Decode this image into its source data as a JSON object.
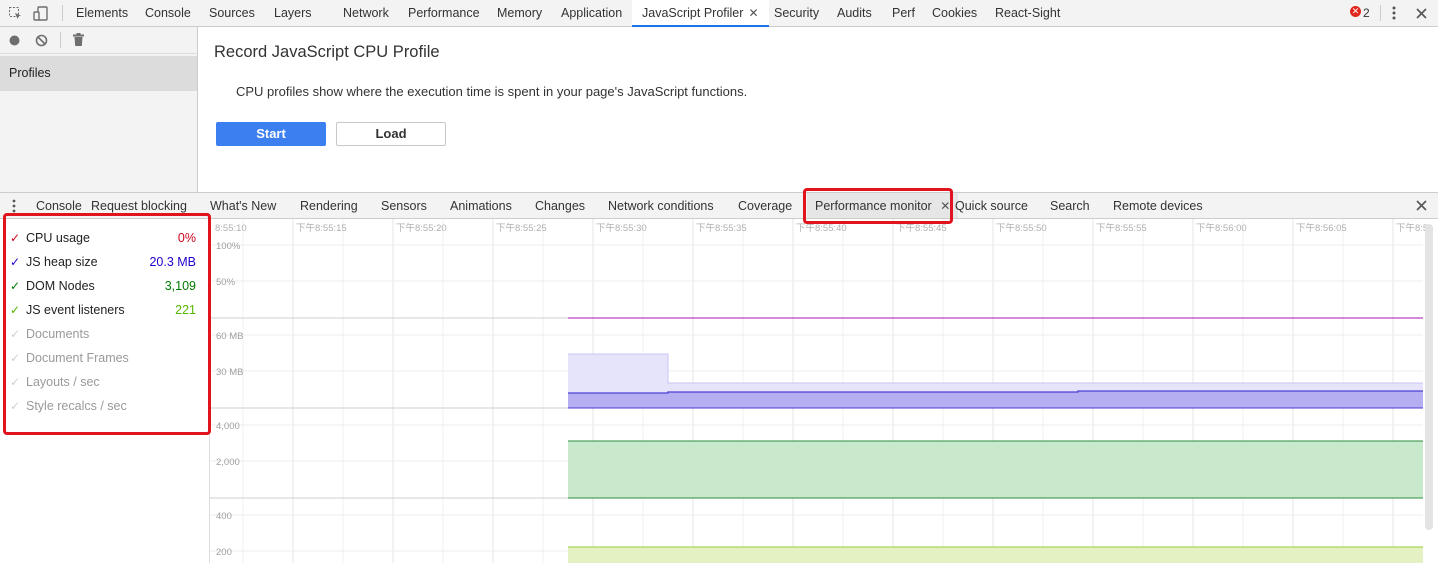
{
  "toolbar": {
    "tabs": [
      "Elements",
      "Console",
      "Sources",
      "Layers",
      "Network",
      "Performance",
      "Memory",
      "Application",
      "JavaScript Profiler",
      "Security",
      "Audits",
      "Perf",
      "Cookies",
      "React-Sight"
    ],
    "active_tab": "JavaScript Profiler",
    "error_count": "2",
    "icons": [
      "inspect-icon",
      "device-toggle-icon",
      "error-icon",
      "more-vert-icon",
      "close-icon"
    ]
  },
  "profiler": {
    "toolbar_icons": [
      "record-icon",
      "clear-icon",
      "trash-icon"
    ],
    "sidebar_item": "Profiles",
    "title": "Record JavaScript CPU Profile",
    "description": "CPU profiles show where the execution time is spent in your page's JavaScript functions.",
    "start_label": "Start",
    "load_label": "Load"
  },
  "drawer": {
    "tabs": [
      "Console",
      "Request blocking",
      "What's New",
      "Rendering",
      "Sensors",
      "Animations",
      "Changes",
      "Network conditions",
      "Coverage",
      "Performance monitor",
      "Quick source",
      "Search",
      "Remote devices"
    ],
    "active_tab": "Performance monitor"
  },
  "metrics": [
    {
      "label": "CPU usage",
      "value": "0%",
      "enabled": true,
      "color": "#d0021b"
    },
    {
      "label": "JS heap size",
      "value": "20.3 MB",
      "enabled": true,
      "color": "#2200cc"
    },
    {
      "label": "DOM Nodes",
      "value": "3,109",
      "enabled": true,
      "color": "#007a00"
    },
    {
      "label": "JS event listeners",
      "value": "221",
      "enabled": true,
      "color": "#55b700"
    },
    {
      "label": "Documents",
      "value": "",
      "enabled": false,
      "color": "#aaaaaa"
    },
    {
      "label": "Document Frames",
      "value": "",
      "enabled": false,
      "color": "#aaaaaa"
    },
    {
      "label": "Layouts / sec",
      "value": "",
      "enabled": false,
      "color": "#aaaaaa"
    },
    {
      "label": "Style recalcs / sec",
      "value": "",
      "enabled": false,
      "color": "#aaaaaa"
    }
  ],
  "chart_data": {
    "type": "area",
    "x_ticks": [
      "8:55:10",
      "下午8:55:15",
      "下午8:55:20",
      "下午8:55:25",
      "下午8:55:30",
      "下午8:55:35",
      "下午8:55:40",
      "下午8:55:45",
      "下午8:55:50",
      "下午8:55:55",
      "下午8:56:00",
      "下午8:56:05",
      "下午8:5"
    ],
    "panes": [
      {
        "name": "CPU usage",
        "y_ticks": [
          "100%",
          "50%"
        ],
        "color": "#c040c0"
      },
      {
        "name": "JS heap size",
        "y_ticks": [
          "60 MB",
          "30 MB"
        ],
        "color": "#4b3fd6"
      },
      {
        "name": "DOM Nodes",
        "y_ticks": [
          "4,000",
          "2,000"
        ],
        "color": "#2e8b3e"
      },
      {
        "name": "JS event listeners",
        "y_ticks": [
          "400",
          "200"
        ],
        "color": "#9acd32"
      }
    ]
  }
}
